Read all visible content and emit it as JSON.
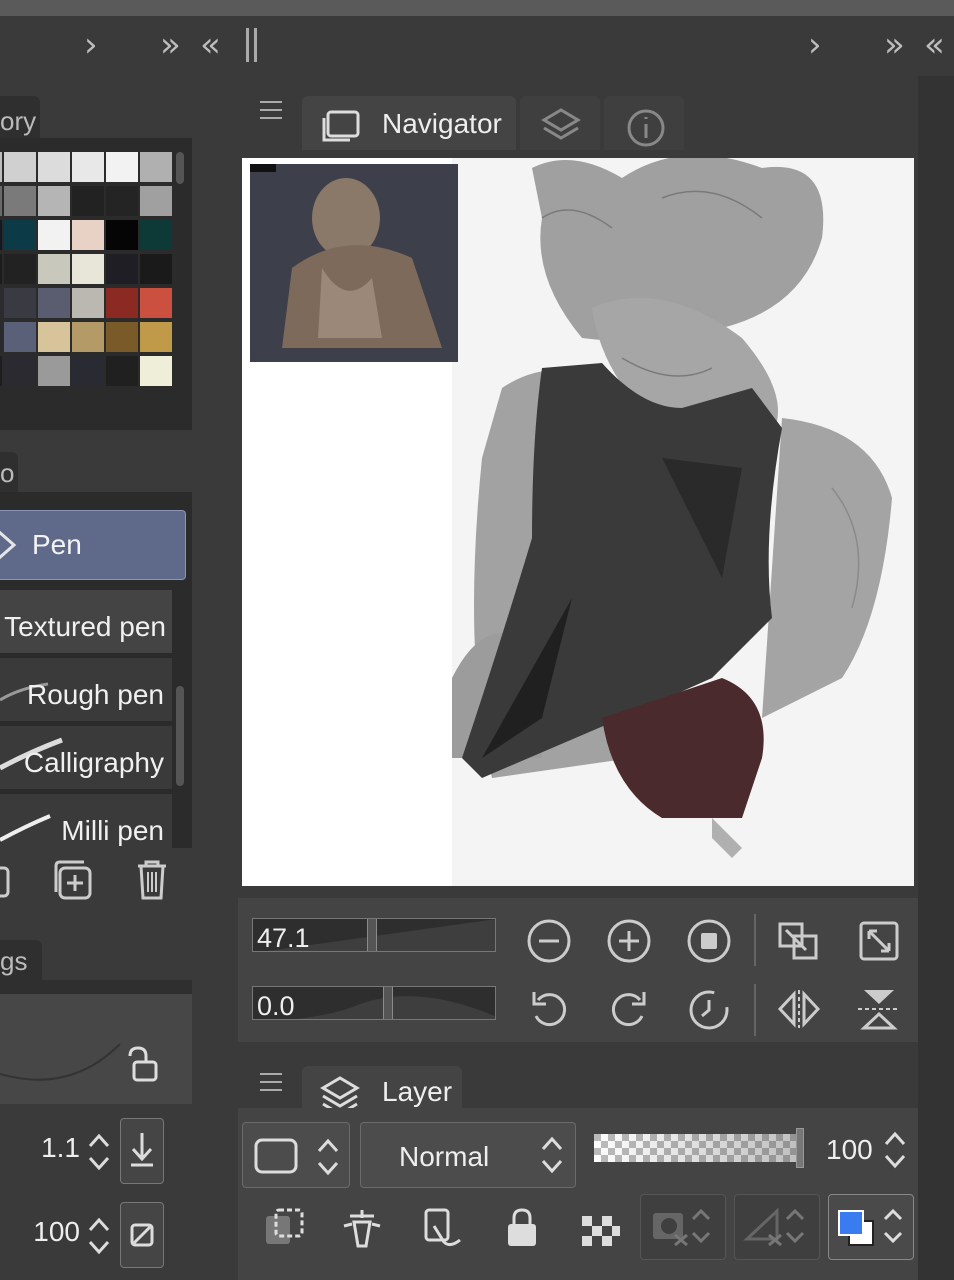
{
  "toolbar": {
    "left_chevron_single": "›",
    "left_chevron_double": "»",
    "left_chevron_back": "«",
    "right_chevron_single": "›",
    "right_chevron_double": "»",
    "right_chevron_back": "«"
  },
  "left_panel": {
    "color_history_tab": "ory",
    "subtool_tab": "o",
    "selected_group": "Pen",
    "pens": [
      "Textured pen",
      "Rough pen",
      "Calligraphy",
      "Milli pen"
    ],
    "settings_tab": "gs",
    "brush_size_value": "1.1",
    "opacity_value": "100"
  },
  "navigator": {
    "tab_label": "Navigator",
    "zoom_value": "47.1",
    "rotation_value": "0.0"
  },
  "layer": {
    "tab_label": "Layer",
    "blend_mode": "Normal",
    "opacity_value": "100"
  },
  "colors": {
    "accent_tab": "#5f6a8a",
    "main_color": "#3a7bf0"
  }
}
